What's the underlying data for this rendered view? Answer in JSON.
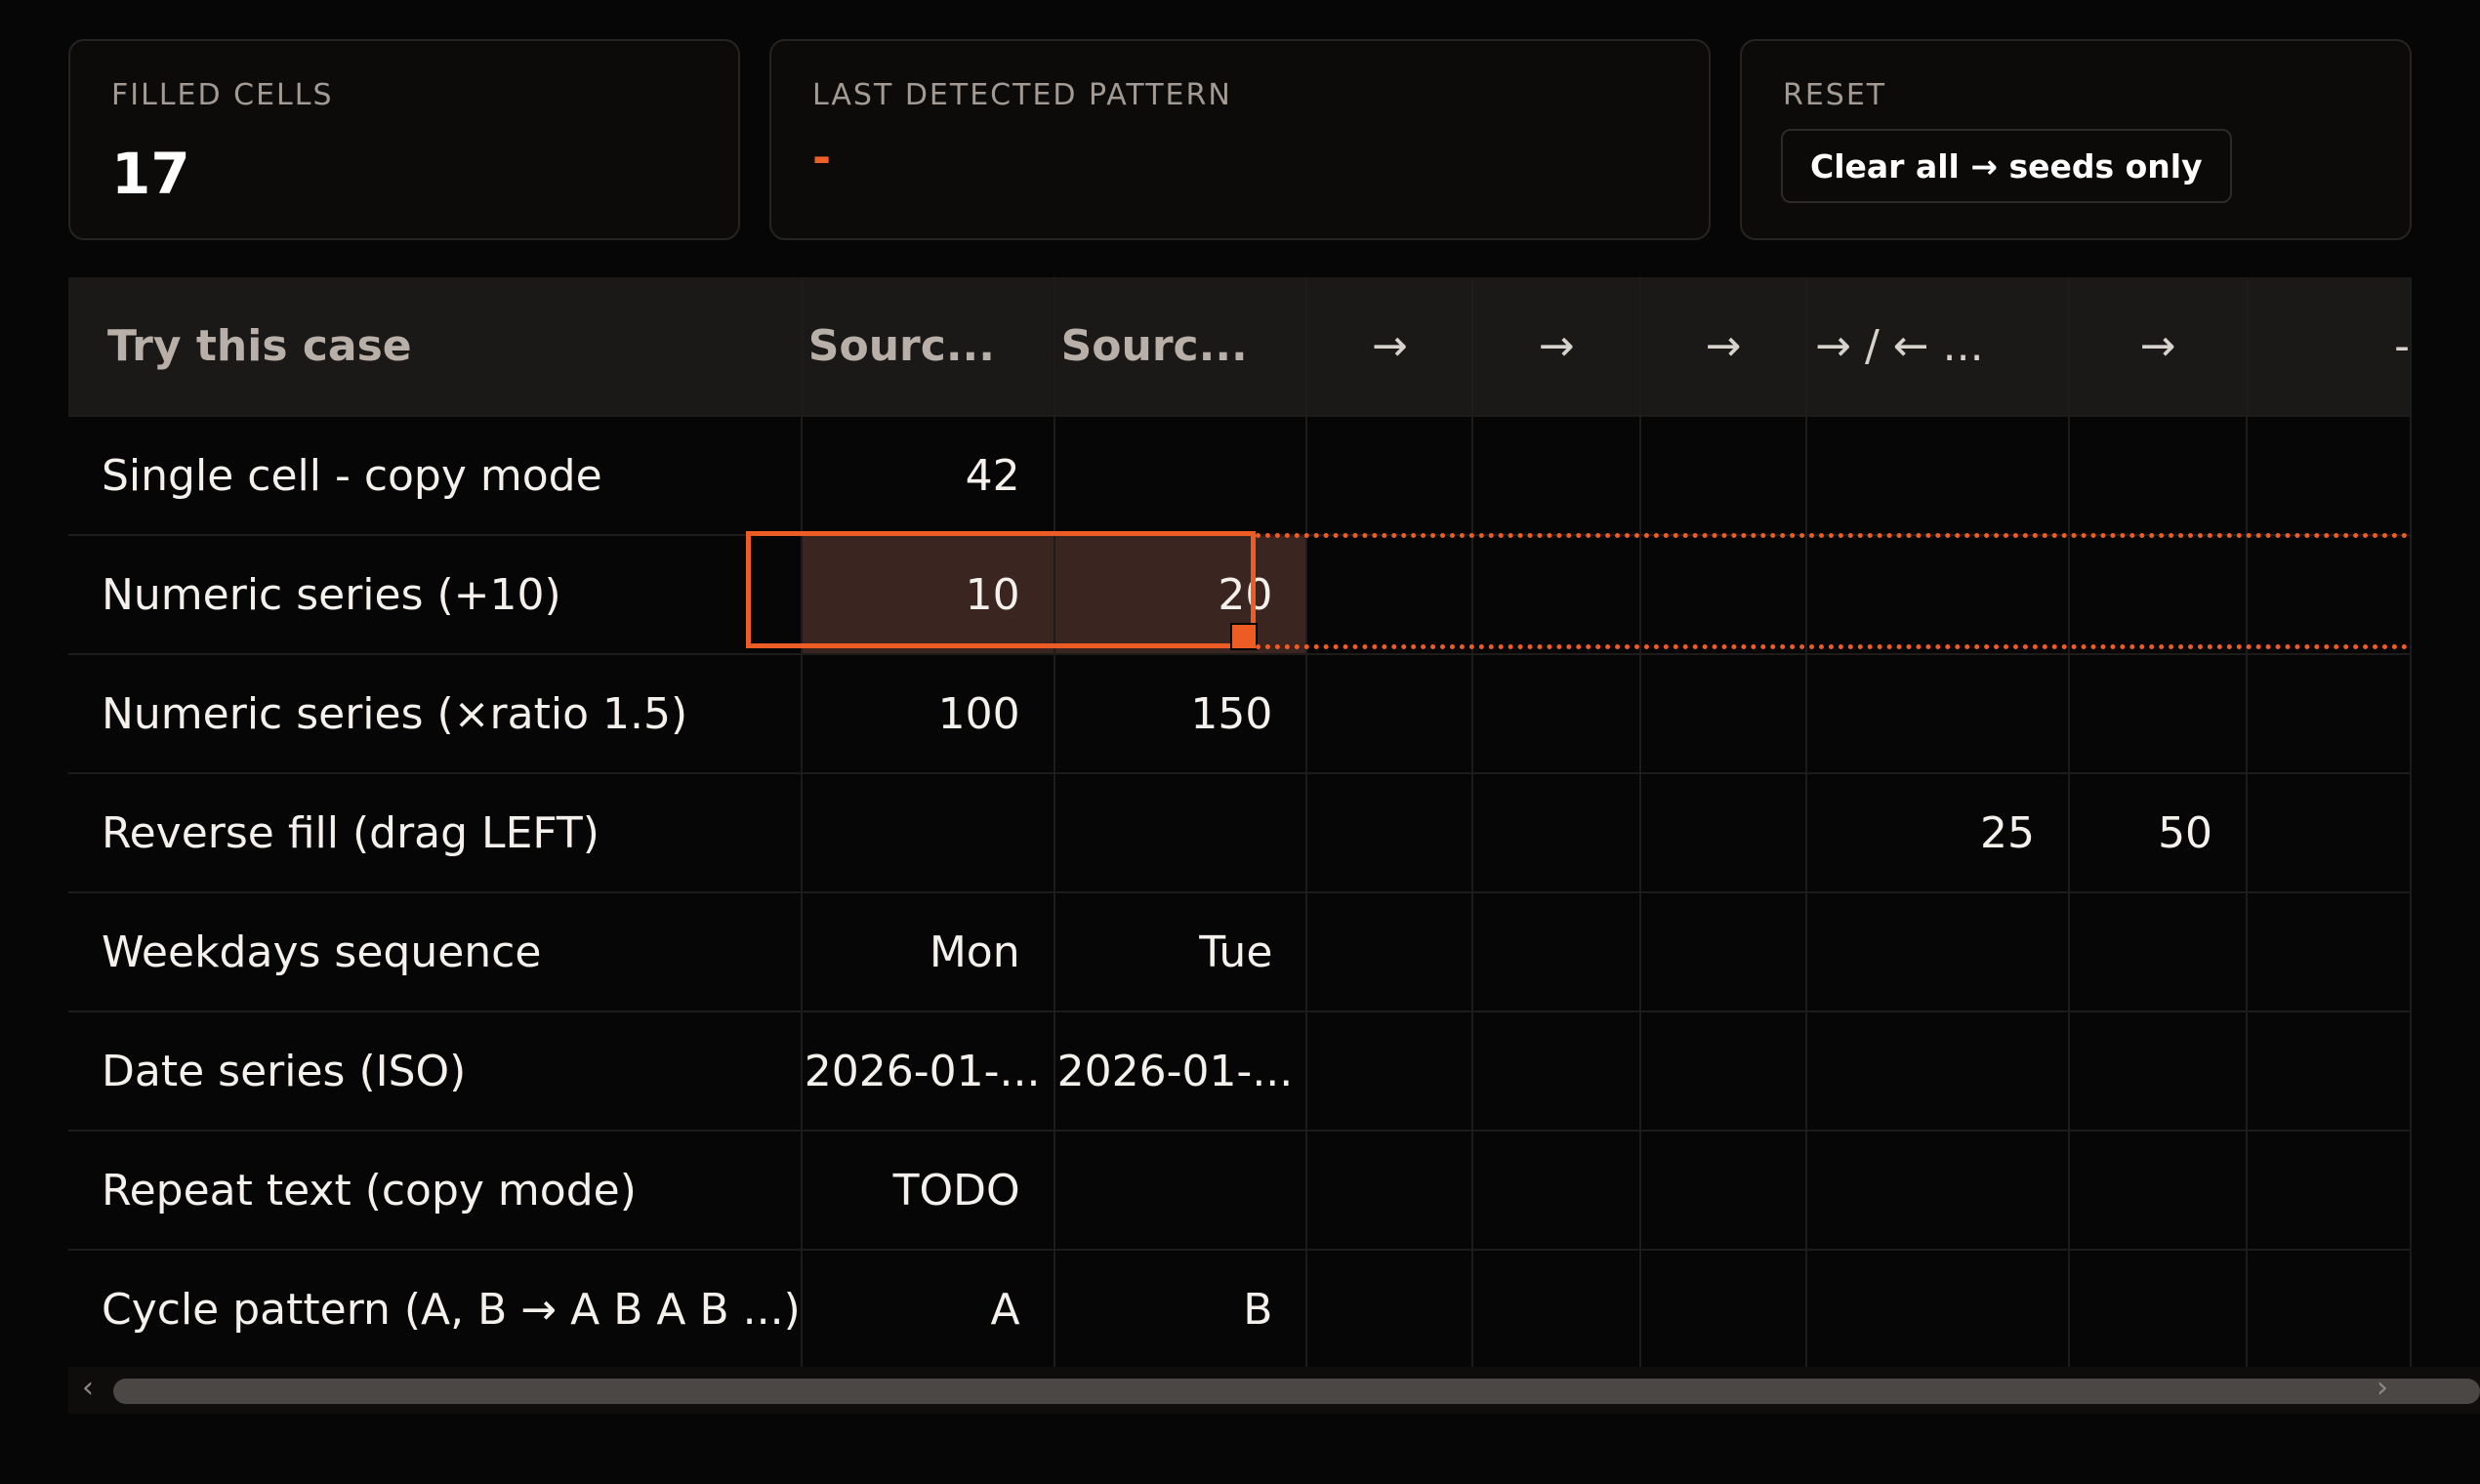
{
  "stats": {
    "filled": {
      "label": "FILLED CELLS",
      "value": "17"
    },
    "pattern": {
      "label": "LAST DETECTED PATTERN",
      "value": "-"
    },
    "reset": {
      "label": "RESET",
      "button_label": "Clear all → seeds only"
    }
  },
  "grid": {
    "headers": [
      "Try this case",
      "Sourc...",
      "Sourc...",
      "→",
      "→",
      "→",
      "→ / ← ...",
      "→",
      "-"
    ],
    "rows": [
      {
        "label": "Single cell - copy mode",
        "cells": [
          "42",
          "",
          "",
          "",
          "",
          "",
          "",
          ""
        ]
      },
      {
        "label": "Numeric series (+10)",
        "cells": [
          "10",
          "20",
          "",
          "",
          "",
          "",
          "",
          ""
        ]
      },
      {
        "label": "Numeric series (×ratio 1.5)",
        "cells": [
          "100",
          "150",
          "",
          "",
          "",
          "",
          "",
          ""
        ]
      },
      {
        "label": "Reverse fill (drag LEFT)",
        "cells": [
          "",
          "",
          "",
          "",
          "",
          "25",
          "50",
          ""
        ]
      },
      {
        "label": "Weekdays sequence",
        "cells": [
          "Mon",
          "Tue",
          "",
          "",
          "",
          "",
          "",
          ""
        ]
      },
      {
        "label": "Date series (ISO)",
        "cells": [
          "2026-01-...",
          "2026-01-...",
          "",
          "",
          "",
          "",
          "",
          ""
        ]
      },
      {
        "label": "Repeat text (copy mode)",
        "cells": [
          "TODO",
          "",
          "",
          "",
          "",
          "",
          "",
          ""
        ]
      },
      {
        "label": "Cycle pattern (A, B → A B A B ...)",
        "cells": [
          "A",
          "B",
          "",
          "",
          "",
          "",
          "",
          ""
        ]
      }
    ]
  },
  "scroll": {
    "left_icon": "chevron-left-icon",
    "right_icon": "chevron-right-icon",
    "left_glyph": "‹",
    "right_glyph": "›"
  },
  "colors": {
    "accent": "#ee5c25",
    "background": "#070606",
    "selected_fill": "#3a2520"
  }
}
